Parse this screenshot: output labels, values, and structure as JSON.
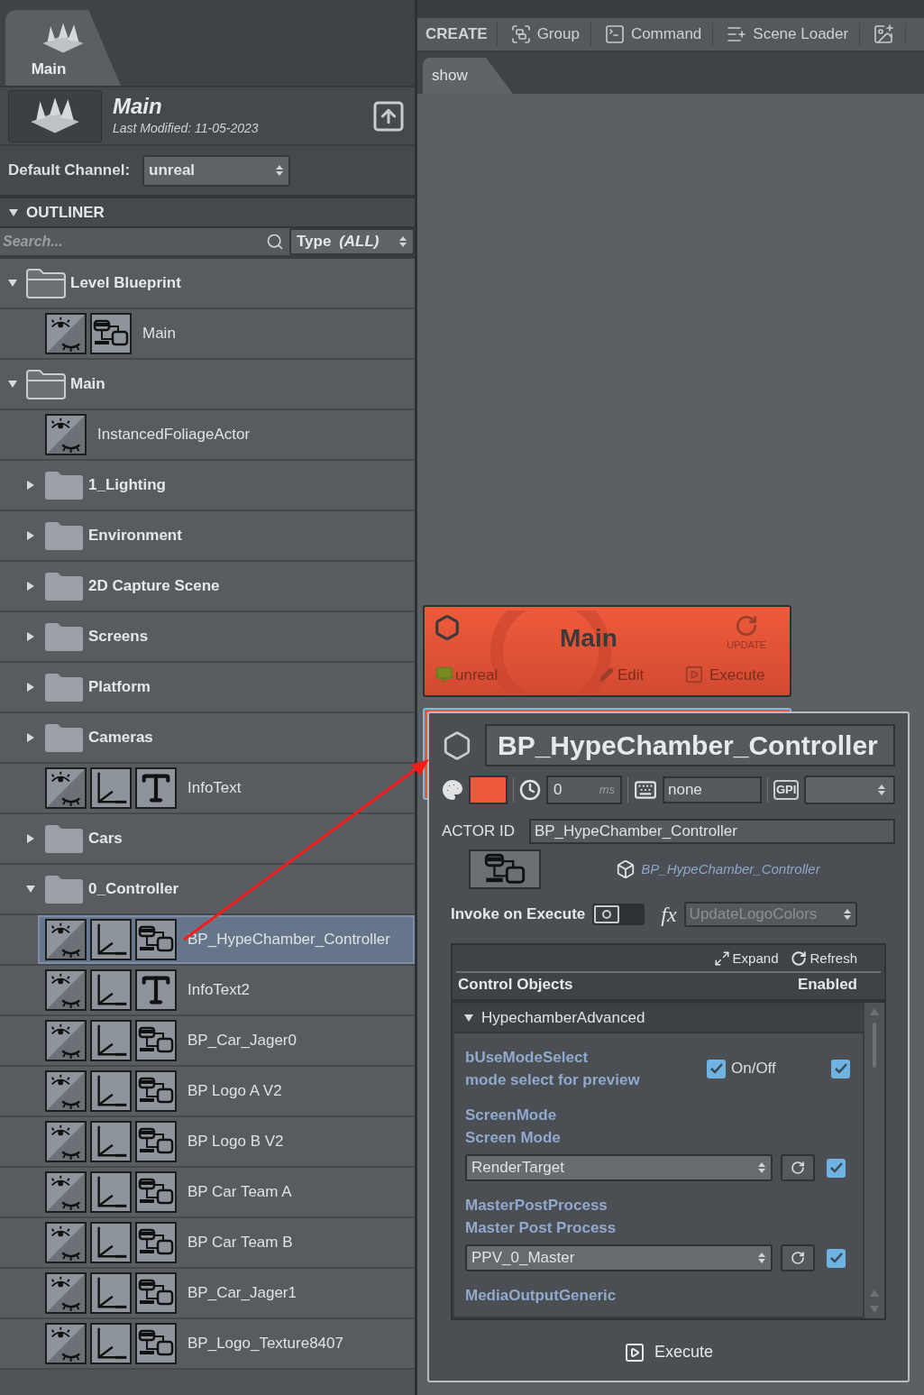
{
  "project_tab": {
    "label": "Main",
    "selected": true
  },
  "project": {
    "title": "Main",
    "last_modified": "Last Modified: 11-05-2023"
  },
  "default_channel": {
    "label": "Default Channel:",
    "value": "unreal"
  },
  "outliner": {
    "title": "OUTLINER",
    "expanded": true,
    "search": {
      "placeholder": "Search..."
    },
    "type_filter": {
      "label": "Type",
      "value": "(ALL)"
    },
    "items": [
      {
        "label": "Level Blueprint",
        "kind": "folder",
        "expanded": true,
        "selected": false,
        "children": [
          {
            "label": "Main",
            "kind": "level",
            "selected": false
          }
        ]
      },
      {
        "label": "Main",
        "kind": "folder",
        "expanded": true,
        "selected": false,
        "children": [
          {
            "label": "InstancedFoliageActor",
            "kind": "foliage",
            "selected": false
          },
          {
            "label": "1_Lighting",
            "kind": "folder",
            "expanded": false,
            "selected": false
          },
          {
            "label": "Environment",
            "kind": "folder",
            "expanded": false,
            "selected": false
          },
          {
            "label": "2D Capture Scene",
            "kind": "folder",
            "expanded": false,
            "selected": false
          },
          {
            "label": "Screens",
            "kind": "folder",
            "expanded": false,
            "selected": false
          },
          {
            "label": "Platform",
            "kind": "folder",
            "expanded": false,
            "selected": false
          },
          {
            "label": "Cameras",
            "kind": "folder",
            "expanded": false,
            "selected": false
          },
          {
            "label": "InfoText",
            "kind": "text",
            "selected": false
          },
          {
            "label": "Cars",
            "kind": "folder",
            "expanded": false,
            "selected": false
          },
          {
            "label": "0_Controller",
            "kind": "folder",
            "expanded": true,
            "selected": false,
            "children": [
              {
                "label": "BP_HypeChamber_Controller",
                "kind": "blueprint",
                "selected": true
              }
            ]
          },
          {
            "label": "InfoText2",
            "kind": "text",
            "selected": false
          },
          {
            "label": "BP_Car_Jager0",
            "kind": "blueprint",
            "selected": false
          },
          {
            "label": "BP Logo A V2",
            "kind": "blueprint",
            "selected": false
          },
          {
            "label": "BP Logo B V2",
            "kind": "blueprint",
            "selected": false
          },
          {
            "label": "BP Car Team A",
            "kind": "blueprint",
            "selected": false
          },
          {
            "label": "BP Car Team B",
            "kind": "blueprint",
            "selected": false
          },
          {
            "label": "BP_Car_Jager1",
            "kind": "blueprint",
            "selected": false
          },
          {
            "label": "BP_Logo_Texture8407",
            "kind": "blueprint",
            "selected": false
          }
        ]
      }
    ]
  },
  "toolbar": {
    "title": "CREATE",
    "buttons": [
      {
        "kind": "group",
        "label": "Group"
      },
      {
        "kind": "command",
        "label": "Command"
      },
      {
        "kind": "scene_loader",
        "label": "Scene Loader"
      },
      {
        "kind": "image"
      }
    ]
  },
  "canvas_tabs": [
    {
      "label": "show",
      "selected": true
    }
  ],
  "action_card": {
    "title": "Main",
    "update": "UPDATE",
    "channel": "unreal",
    "edit": "Edit",
    "execute": "Execute"
  },
  "inspector": {
    "title": "BP_HypeChamber_Controller",
    "delay": {
      "value": "0",
      "unit": "ms"
    },
    "shortcut": "none",
    "gpi_label": "GPI",
    "actor_id": {
      "label": "ACTOR ID",
      "value": "BP_HypeChamber_Controller"
    },
    "actor_link": "BP_HypeChamber_Controller",
    "invoke": {
      "label": "Invoke on Execute",
      "on": false,
      "fx_label": "fx",
      "function": "UpdateLogoColors",
      "disabled": true
    },
    "control_objects": {
      "expand": "Expand",
      "refresh": "Refresh",
      "title": "Control Objects",
      "enabled_label": "Enabled",
      "group": {
        "label": "HypechamberAdvanced",
        "expanded": true
      },
      "properties": [
        {
          "kind": "checkbox",
          "name": "bUseModeSelect",
          "description": "mode select for preview",
          "value_label": "On/Off",
          "checked": true,
          "enabled": true
        },
        {
          "kind": "select",
          "name": "ScreenMode",
          "description": "Screen Mode",
          "value": "RenderTarget",
          "enabled": true
        },
        {
          "kind": "select",
          "name": "MasterPostProcess",
          "description": "Master Post Process",
          "value": "PPV_0_Master",
          "enabled": true
        },
        {
          "kind": "header",
          "name": "MediaOutputGeneric"
        }
      ]
    },
    "execute": "Execute"
  }
}
